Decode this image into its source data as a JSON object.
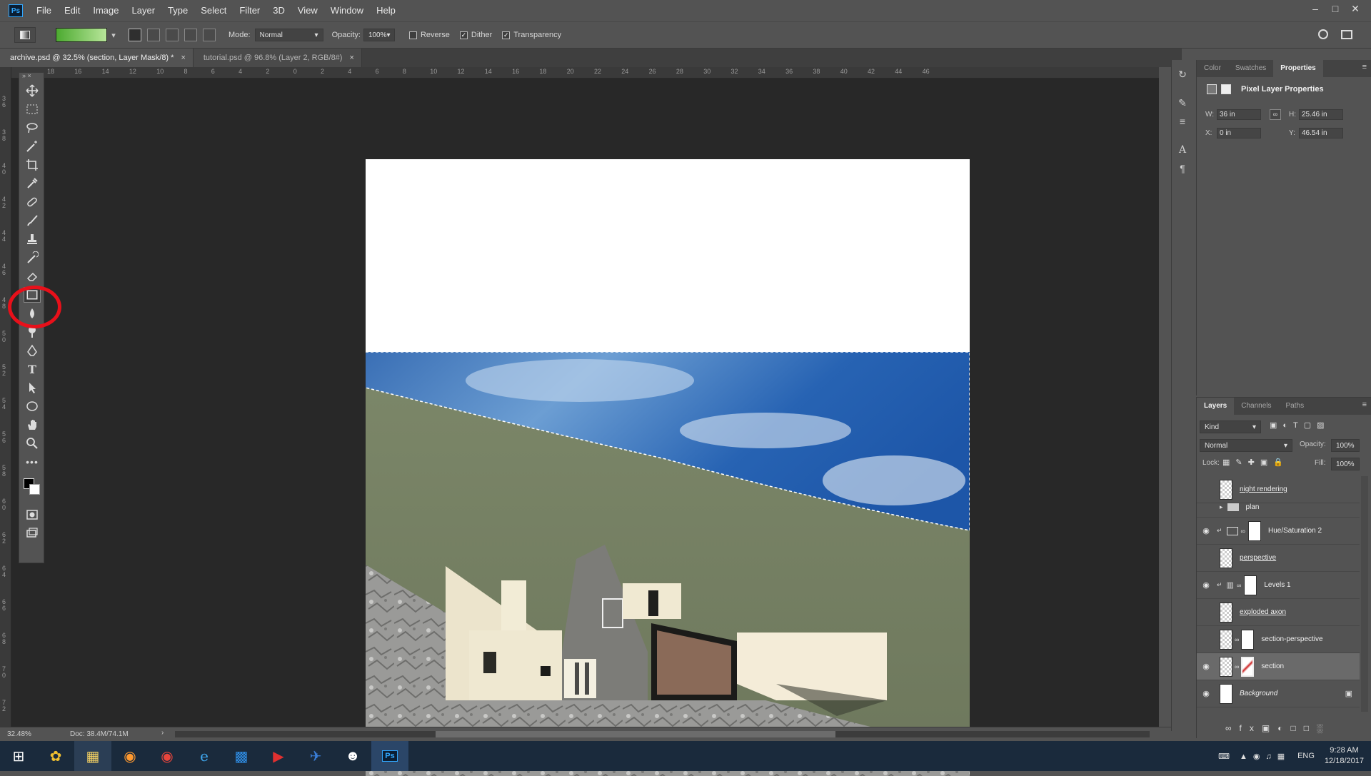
{
  "app": {
    "logo_text": "Ps"
  },
  "menu": [
    "File",
    "Edit",
    "Image",
    "Layer",
    "Type",
    "Select",
    "Filter",
    "3D",
    "View",
    "Window",
    "Help"
  ],
  "options": {
    "mode_label": "Mode:",
    "mode_value": "Normal",
    "opacity_label": "Opacity:",
    "opacity_value": "100%",
    "reverse_label": "Reverse",
    "reverse_checked": false,
    "dither_label": "Dither",
    "dither_checked": true,
    "transparency_label": "Transparency",
    "transparency_checked": true,
    "gradient_colors": [
      "#4caa30",
      "#b8e69a"
    ]
  },
  "tabs": [
    {
      "label": "archive.psd @ 32.5% (section, Layer Mask/8) *",
      "active": true
    },
    {
      "label": "tutorial.psd @ 96.8% (Layer 2, RGB/8#)",
      "active": false
    }
  ],
  "ruler_top": [
    "18",
    "16",
    "14",
    "12",
    "10",
    "8",
    "6",
    "4",
    "2",
    "0",
    "2",
    "4",
    "6",
    "8",
    "10",
    "12",
    "14",
    "16",
    "18",
    "20",
    "22",
    "24",
    "26",
    "28",
    "30",
    "32",
    "34",
    "36",
    "38",
    "40",
    "42",
    "44",
    "46"
  ],
  "ruler_left": [
    "3 6",
    "3 8",
    "4 0",
    "4 2",
    "4 4",
    "4 6",
    "4 8",
    "5 0",
    "5 2",
    "5 4",
    "5 6",
    "5 8",
    "6 0",
    "6 2",
    "6 4",
    "6 6",
    "6 8",
    "7 0",
    "7 2"
  ],
  "properties": {
    "tabs": [
      "Color",
      "Swatches",
      "Properties"
    ],
    "active_tab": "Properties",
    "heading": "Pixel Layer Properties",
    "w_label": "W:",
    "w_value": "36 in",
    "h_label": "H:",
    "h_value": "25.46 in",
    "x_label": "X:",
    "x_value": "0 in",
    "y_label": "Y:",
    "y_value": "46.54 in"
  },
  "layers_panel": {
    "tabs": [
      "Layers",
      "Channels",
      "Paths"
    ],
    "active_tab": "Layers",
    "filter_value": "Kind",
    "blend_mode": "Normal",
    "opacity_label": "Opacity:",
    "opacity_value": "100%",
    "lock_label": "Lock:",
    "fill_label": "Fill:",
    "fill_value": "100%",
    "layers": [
      {
        "name": "night rendering",
        "visible": false,
        "style": "ul"
      },
      {
        "name": "plan",
        "visible": false,
        "style": "group"
      },
      {
        "name": "Hue/Saturation 2",
        "visible": true,
        "style": "adj"
      },
      {
        "name": "perspective",
        "visible": false,
        "style": "ul"
      },
      {
        "name": "Levels 1",
        "visible": true,
        "style": "adj"
      },
      {
        "name": "exploded axon",
        "visible": false,
        "style": "ul"
      },
      {
        "name": "section-perspective",
        "visible": false,
        "style": "mask"
      },
      {
        "name": "section",
        "visible": true,
        "style": "mask-selected"
      },
      {
        "name": "Background",
        "visible": true,
        "style": "it"
      }
    ]
  },
  "status": {
    "zoom": "32.48%",
    "doc": "Doc: 38.4M/74.1M"
  },
  "tray": {
    "lang": "ENG",
    "time": "9:28 AM",
    "date": "12/18/2017"
  }
}
